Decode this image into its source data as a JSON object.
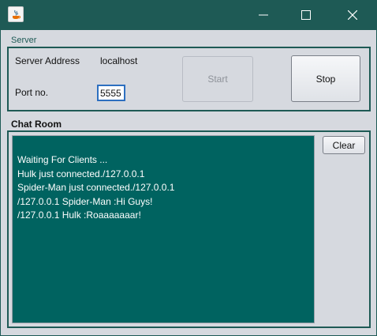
{
  "window": {
    "title": ""
  },
  "server_group": {
    "title": "Server",
    "address_label": "Server Address",
    "address_value": "localhost",
    "port_label": "Port no.",
    "port_value": "5555",
    "start_label": "Start",
    "stop_label": "Stop"
  },
  "chat_room": {
    "title": "Chat Room",
    "clear_label": "Clear",
    "messages": [
      "Waiting For Clients ...",
      "Hulk just connected./127.0.0.1",
      "Spider-Man just connected./127.0.0.1",
      "/127.0.0.1 Spider-Man :Hi Guys!",
      "/127.0.0.1 Hulk :Roaaaaaaar!"
    ]
  },
  "colors": {
    "title_bar": "#1e5a55",
    "chat_background": "#006360",
    "panel_background": "#d6d9df"
  }
}
